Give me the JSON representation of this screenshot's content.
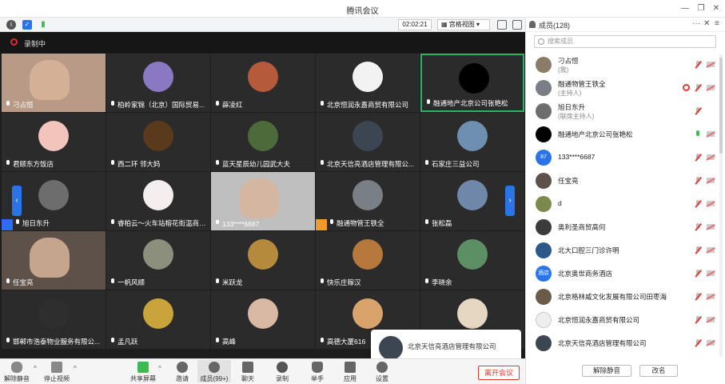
{
  "window": {
    "title": "腾讯会议"
  },
  "infobar": {
    "timer": "02:02:21",
    "view_label": "宫格视图"
  },
  "recording": {
    "label": "录制中"
  },
  "tiles": [
    {
      "name": "刁占恒",
      "bg": "#b89a86",
      "av": null,
      "cam": true
    },
    {
      "name": "柏岭家锦（北京）国际贸易...",
      "bg": "#2b2b2b",
      "av": "#8a79c2"
    },
    {
      "name": "薛凌红",
      "bg": "#2b2b2b",
      "av": "#b55a3b"
    },
    {
      "name": "北京恒润永嘉商贸有限公司",
      "bg": "#2b2b2b",
      "av": "#f2f2f2"
    },
    {
      "name": "融通地产北京公司张艳松",
      "bg": "#2b2b2b",
      "av": "#000000",
      "active": true
    },
    {
      "name": "君颐东方饭店",
      "bg": "#2b2b2b",
      "av": "#f3c4bb"
    },
    {
      "name": "西二环 邻大妈",
      "bg": "#2b2b2b",
      "av": "#5a3a1c"
    },
    {
      "name": "蓝天星辰幼儿园武大夫",
      "bg": "#2b2b2b",
      "av": "#4d6a3a"
    },
    {
      "name": "北京天信亮酒店管理有限公...",
      "bg": "#2b2b2b",
      "av": "#3b4652"
    },
    {
      "name": "石家庄三益公司",
      "bg": "#2b2b2b",
      "av": "#6f8fb1"
    },
    {
      "name": "旭日东升",
      "bg": "#2b2b2b",
      "av": "#6d6d6d",
      "host": "blue"
    },
    {
      "name": "睿柏云～火车站榕花街温商会...",
      "bg": "#2b2b2b",
      "av": "#f4eeee"
    },
    {
      "name": "133****6687",
      "bg": "#bfbfbf",
      "av": null,
      "cam": true
    },
    {
      "name": "融通物管王铁全",
      "bg": "#2b2b2b",
      "av": "#7a7f85",
      "host": "orange"
    },
    {
      "name": "张松磊",
      "bg": "#2b2b2b",
      "av": "#6f88aa"
    },
    {
      "name": "任宝亮",
      "bg": "#5d514a",
      "av": null,
      "cam": true
    },
    {
      "name": "一帆风顺",
      "bg": "#2b2b2b",
      "av": "#8b8f7c"
    },
    {
      "name": "米跃龙",
      "bg": "#2b2b2b",
      "av": "#b58a3c"
    },
    {
      "name": "快乐庄稼汉",
      "bg": "#2b2b2b",
      "av": "#b7793b"
    },
    {
      "name": "李晓余",
      "bg": "#2b2b2b",
      "av": "#5c8f63"
    },
    {
      "name": "邯郸市浩泰物业服务有限公...",
      "bg": "#2b2b2b",
      "av": "#2e2e2e"
    },
    {
      "name": "孟凡跃",
      "bg": "#2b2b2b",
      "av": "#c9a43b"
    },
    {
      "name": "高峰",
      "bg": "#2b2b2b",
      "av": "#d9b9a4"
    },
    {
      "name": "高德大厦616",
      "bg": "#2b2b2b",
      "av": "#d8a46b"
    },
    {
      "name": "",
      "bg": "#2b2b2b",
      "av": "#e6d7c2"
    }
  ],
  "popup": {
    "text": "北京天信亮酒店管理有限公司"
  },
  "toolbar": {
    "unmute": "解除静音",
    "stop_video": "停止视频",
    "share": "共享屏幕",
    "invite": "邀请",
    "members": "成员(99+)",
    "chat": "聊天",
    "record": "录制",
    "raise_hand": "举手",
    "apps": "应用",
    "settings": "设置",
    "leave": "离开会议"
  },
  "panel": {
    "title": "成员(128)",
    "search_placeholder": "搜索成员",
    "unmute_btn": "解除静音",
    "rename_btn": "改名",
    "members": [
      {
        "name": "刁占恒",
        "role": "(我)",
        "av": "#8d7b6a",
        "mic": "muted",
        "cam": "off"
      },
      {
        "name": "融通物管王铁全",
        "role": "(主持人)",
        "av": "#7a7f85",
        "mic": "muted",
        "cam": "off",
        "rec": true
      },
      {
        "name": "旭日东升",
        "role": "(联席主持人)",
        "av": "#6d6d6d",
        "mic": "muted",
        "cam": "none"
      },
      {
        "name": "融通地产北京公司张艳松",
        "role": "",
        "av": "#000000",
        "mic": "on",
        "cam": "off"
      },
      {
        "name": "133****6687",
        "role": "",
        "av": "#2a74e8",
        "avtext": "87",
        "mic": "muted",
        "cam": "off"
      },
      {
        "name": "任宝亮",
        "role": "",
        "av": "#5d514a",
        "mic": "muted",
        "cam": "off"
      },
      {
        "name": "d",
        "role": "",
        "av": "#7a8a4a",
        "mic": "muted",
        "cam": "off"
      },
      {
        "name": "奥利圣商贸高何",
        "role": "",
        "av": "#3b3b3b",
        "mic": "muted",
        "cam": "off"
      },
      {
        "name": "北大口腔三门诊许明",
        "role": "",
        "av": "#2b5a8a",
        "mic": "muted",
        "cam": "off"
      },
      {
        "name": "北京奥世商务酒店",
        "role": "",
        "av": "#2a74e8",
        "avtext": "酒店",
        "mic": "muted",
        "cam": "off"
      },
      {
        "name": "北京格林威文化发展有限公司田枣海",
        "role": "",
        "av": "#6a5a4a",
        "mic": "muted",
        "cam": "off"
      },
      {
        "name": "北京恒润永嘉商贸有限公司",
        "role": "",
        "av": "#eeeeee",
        "mic": "muted",
        "cam": "off"
      },
      {
        "name": "北京天信亮酒店管理有限公司",
        "role": "",
        "av": "#3b4652",
        "mic": "muted",
        "cam": "off"
      }
    ]
  }
}
